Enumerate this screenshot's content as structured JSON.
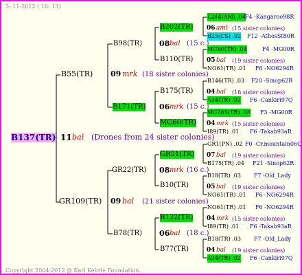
{
  "header": {
    "date": "3- 11-2012 ( 16: 13)"
  },
  "footer": {
    "copyright": "Copyright 2004-2012 @ Karl Kehrle Foundation."
  },
  "root": {
    "id": "B137(TR)",
    "num": "11",
    "breed": "bal",
    "info": "(Drones from 24 sister colonies)"
  },
  "gen1": [
    {
      "id": "B55(TR)",
      "num": "09",
      "breed": "mrk",
      "info": "(18 sister colonies)"
    },
    {
      "id": "GR109(TR)",
      "num": "09",
      "breed": "bal",
      "info": "(21 sister colonies)"
    }
  ],
  "gen2": [
    {
      "id": "B98(TR)",
      "num": "08",
      "breed": "bal",
      "info": "(15 c.)"
    },
    {
      "id": "B171(TR)",
      "num": "06",
      "breed": "mrk",
      "info": "(15 c.)"
    },
    {
      "id": "GR22(TR)",
      "num": "08",
      "breed": "mrk",
      "info": "(16 c.)"
    },
    {
      "id": "B78(TR)",
      "num": "06",
      "breed": "bal",
      "info": "(18 c.)"
    }
  ],
  "gen3": [
    {
      "id": "B202(TR)",
      "num": "06",
      "breed": "aml",
      "info": "(15 sister colonies)"
    },
    {
      "id": "B110(TR)",
      "num": "05",
      "breed": "bal",
      "info": "(19 sister colonies)"
    },
    {
      "id": "B175(TR)",
      "num": "04",
      "breed": "bal",
      "info": "(18 sister colonies)"
    },
    {
      "id": "MG60(TR)",
      "num": "04",
      "breed": "mrk",
      "info": "(15 sister colonies)"
    },
    {
      "id": "GR51(TR)",
      "num": "07",
      "breed": "bal",
      "info": "(19 sister colonies)"
    },
    {
      "id": "B10(TR)",
      "num": "05",
      "breed": "bal",
      "info": "(19 sister colonies)"
    },
    {
      "id": "B132(TR)",
      "num": "04",
      "breed": "mrk",
      "info": "(15 sister colonies)"
    },
    {
      "id": "B77(TR)",
      "num": "04",
      "breed": "bal",
      "info": "(19 sister colonies)"
    }
  ],
  "gen4": [
    {
      "left": "L244(AM) .04",
      "right": "F4 -Kangaroo98R"
    },
    {
      "left": "B25(CS) .02",
      "right": "F12 -AthosSt80R"
    },
    {
      "left": "MG60(TR) .04",
      "right": "F4 -MG00R"
    },
    {
      "left": "NO61(TR) .01",
      "right": "F6 -NO6294R"
    },
    {
      "left": "B146(TR) .03",
      "right": "F20 -Sinop62R"
    },
    {
      "left": "A34(TR) .02",
      "right": "F6 -Cankiri97Q"
    },
    {
      "left": "MG165(TR) .03",
      "right": "F3 -MG00R"
    },
    {
      "left": "I89(TR) .01",
      "right": "F6 -Takab93aR"
    },
    {
      "left": "GR1(PN) .02",
      "right": "F0 -Cr.mountain06Q"
    },
    {
      "left": "B175(TR) .04",
      "right": "F21 -Sinop62R"
    },
    {
      "left": "B18(TR) .03",
      "right": "F7 -Old_Lady"
    },
    {
      "left": "NO61(TR) .01",
      "right": "F6 -NO6294R"
    },
    {
      "left": "NO61(TR) .01",
      "right": "F6 -NO6294R"
    },
    {
      "left": "I89(TR) .01",
      "right": "F6 -Takab93aR"
    },
    {
      "left": "B18(TR) .03",
      "right": "F7 -Old_Lady"
    },
    {
      "left": "A34(TR) .02",
      "right": "F6 -Cankiri97Q"
    }
  ]
}
